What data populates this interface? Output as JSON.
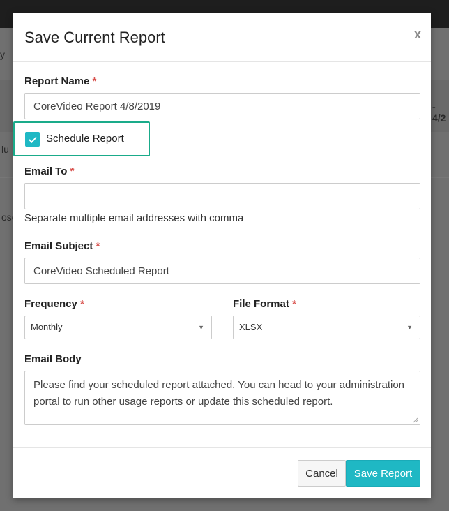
{
  "background": {
    "fragments": [
      "y",
      "- 4/2",
      "lu",
      "osc"
    ]
  },
  "modal": {
    "title": "Save Current Report",
    "close_label": "x",
    "required_mark": "*",
    "report_name": {
      "label": "Report Name",
      "value": "CoreVideo Report 4/8/2019"
    },
    "schedule": {
      "label": "Schedule Report",
      "checked": true
    },
    "email_to": {
      "label": "Email To",
      "value": "",
      "help": "Separate multiple email addresses with comma"
    },
    "email_subject": {
      "label": "Email Subject",
      "value": "CoreVideo Scheduled Report"
    },
    "frequency": {
      "label": "Frequency",
      "selected": "Monthly"
    },
    "file_format": {
      "label": "File Format",
      "selected": "XLSX"
    },
    "email_body": {
      "label": "Email Body",
      "value": "Please find your scheduled report attached. You can head to your administration portal to run other usage reports or update this scheduled report."
    },
    "footer": {
      "cancel_label": "Cancel",
      "save_label": "Save Report"
    }
  },
  "colors": {
    "accent": "#1fb8c4",
    "highlight_border": "#1aab8a",
    "required": "#d9534f"
  },
  "icons": [
    "close-icon",
    "checkmark-icon",
    "caret-down-icon",
    "resize-grip-icon"
  ]
}
